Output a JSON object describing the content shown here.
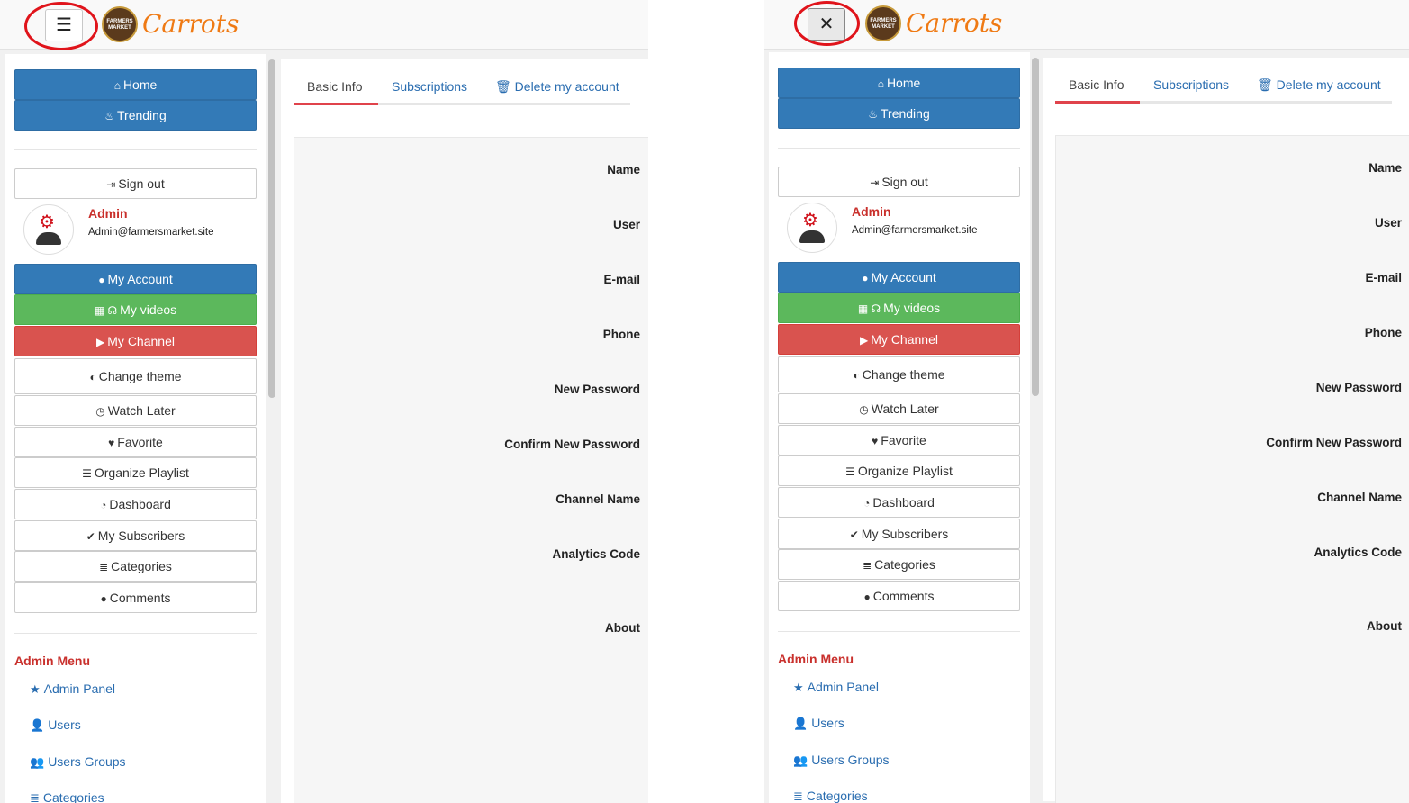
{
  "brand": {
    "name": "Carrots",
    "logo_text": "FARMERS MARKET"
  },
  "menu_toggle": {
    "open_icon": "☰",
    "close_icon": "✕"
  },
  "nav": [
    {
      "label": "Home",
      "icon": "home-icon",
      "glyph": "⌂"
    },
    {
      "label": "Trending",
      "icon": "fire-icon",
      "glyph": "♨"
    }
  ],
  "signout": {
    "label": "Sign out",
    "icon": "signout-icon",
    "glyph": "⇥"
  },
  "user": {
    "name": "Admin",
    "email": "Admin@farmersmarket.site"
  },
  "account_menu": [
    {
      "label": "My Account",
      "glyph": "●",
      "style": "blue"
    },
    {
      "label": "My videos",
      "glyph": "▦ ☊",
      "style": "green"
    },
    {
      "label": "My Channel",
      "glyph": "▶",
      "style": "red"
    },
    {
      "label": "Change theme",
      "glyph": "◐",
      "style": "default"
    },
    {
      "label": "Watch Later",
      "glyph": "◷",
      "style": "default"
    },
    {
      "label": "Favorite",
      "glyph": "♥",
      "style": "default"
    },
    {
      "label": "Organize Playlist",
      "glyph": "☰",
      "style": "default"
    },
    {
      "label": "Dashboard",
      "glyph": "◔",
      "style": "default"
    },
    {
      "label": "My Subscribers",
      "glyph": "✔",
      "style": "default"
    },
    {
      "label": "Categories",
      "glyph": "≣",
      "style": "default"
    },
    {
      "label": "Comments",
      "glyph": "●",
      "style": "default"
    }
  ],
  "admin_menu": {
    "title": "Admin Menu",
    "items": [
      {
        "label": "Admin Panel",
        "glyph": "★"
      },
      {
        "label": "Users",
        "glyph": "👤"
      },
      {
        "label": "Users Groups",
        "glyph": "👥"
      },
      {
        "label": "Categories",
        "glyph": "≣"
      }
    ]
  },
  "tabs": [
    {
      "label": "Basic Info"
    },
    {
      "label": "Subscriptions"
    },
    {
      "label": "Delete my account",
      "glyph": "🗑"
    }
  ],
  "form_labels": [
    "Name",
    "User",
    "E-mail",
    "Phone",
    "New Password",
    "Confirm New Password",
    "Channel Name",
    "Analytics Code",
    "About"
  ],
  "colors": {
    "primary": "#337ab7",
    "success": "#5cb85c",
    "danger": "#d9534f",
    "brand": "#ef7a14",
    "highlight": "#e0141b"
  }
}
